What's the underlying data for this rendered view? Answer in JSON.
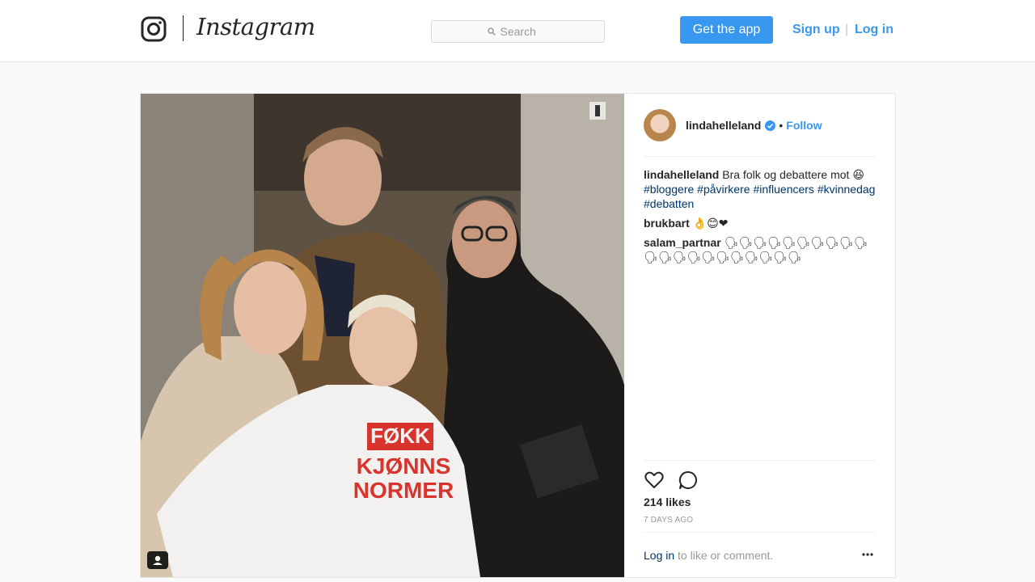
{
  "topbar": {
    "brand": "Instagram",
    "search_placeholder": "Search",
    "get_app_label": "Get the app",
    "signup_label": "Sign up",
    "separator": "|",
    "login_label": "Log in"
  },
  "post": {
    "author": {
      "username": "lindahelleland",
      "verified": true,
      "follow_label": "Follow",
      "dot": "•"
    },
    "caption": {
      "username": "lindahelleland",
      "text": "Bra folk og debattere mot 😆",
      "hashtags": [
        "#bloggere",
        "#påvirkere",
        "#influencers",
        "#kvinnedag",
        "#debatten"
      ]
    },
    "comments": [
      {
        "username": "brukbart",
        "text": "👌😊❤"
      },
      {
        "username": "salam_partnar",
        "text": "🗣🗣🗣🗣🗣🗣🗣🗣🗣🗣🗣🗣🗣🗣🗣🗣🗣🗣🗣🗣🗣"
      }
    ],
    "likes": "214 likes",
    "date": "7 DAYS AGO",
    "login_link": "Log in",
    "login_prompt": " to like or comment."
  },
  "colors": {
    "accent": "#3897f0",
    "hashtag": "#003569",
    "muted": "#999999"
  },
  "icons": [
    "instagram-glyph-icon",
    "search-icon",
    "verified-badge-icon",
    "heart-icon",
    "comment-icon",
    "more-options-icon",
    "tagged-user-icon"
  ]
}
